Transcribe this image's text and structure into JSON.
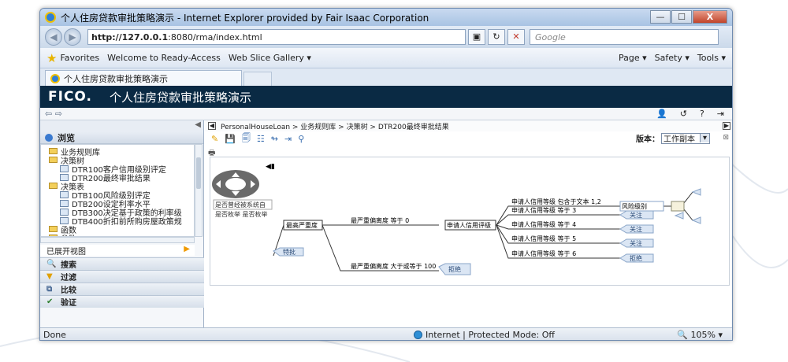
{
  "window": {
    "title": "个人住房贷款审批策略演示 - Internet Explorer provided by Fair Isaac Corporation",
    "controls": {
      "minimize": "—",
      "maximize": "☐",
      "close": "X"
    }
  },
  "address_bar": {
    "url_host": "http://127.0.0.1",
    "url_rest": ":8080/rma/index.html",
    "search_placeholder": "Google"
  },
  "favorites_bar": {
    "favorites_label": "Favorites",
    "links": [
      "Welcome to Ready-Access",
      "Web Slice Gallery ▾"
    ],
    "commands": [
      "Page ▾",
      "Safety ▾",
      "Tools ▾"
    ]
  },
  "tab": {
    "label": "个人住房贷款审批策略演示"
  },
  "app": {
    "logo": "FICO.",
    "title": "个人住房贷款审批策略演示"
  },
  "left_panel": {
    "browse_label": "浏览",
    "tree_items": [
      {
        "label": "业务规则库",
        "type": "folder",
        "indent": 1
      },
      {
        "label": "决策树",
        "type": "folder",
        "indent": 1
      },
      {
        "label": "DTR100客户信用级别评定",
        "type": "file",
        "indent": 2
      },
      {
        "label": "DTR200最终审批结果",
        "type": "file",
        "indent": 2
      },
      {
        "label": "决策表",
        "type": "folder",
        "indent": 1
      },
      {
        "label": "DTB100风险级别评定",
        "type": "file",
        "indent": 2
      },
      {
        "label": "DTB200设定利率水平",
        "type": "file",
        "indent": 2
      },
      {
        "label": "DTB300决定基于政策的利率级",
        "type": "file",
        "indent": 2
      },
      {
        "label": "DTB400折扣前所购房屋政策规",
        "type": "file",
        "indent": 2
      },
      {
        "label": "函数",
        "type": "folder",
        "indent": 1
      },
      {
        "label": "参数",
        "type": "folder",
        "indent": 1
      }
    ],
    "expand_all": "已展开视图",
    "accordion": [
      {
        "label": "搜索",
        "icon": "magnifier-icon"
      },
      {
        "label": "过滤",
        "icon": "filter-icon"
      },
      {
        "label": "比较",
        "icon": "compare-icon"
      },
      {
        "label": "验证",
        "icon": "check-icon"
      }
    ]
  },
  "breadcrumb": "PersonalHouseLoan > 业务规则库 > 决策树 > DTR200最终审批结果",
  "version": {
    "label": "版本：",
    "value": "工作副本"
  },
  "tree": {
    "legend_lines": [
      "是否曾经被系统自",
      "是否枚举 是否枚举"
    ],
    "root": "最高严重度",
    "left_child": "特批",
    "branch_top": "最严重偏离度 等于 0",
    "branch_bottom": "最严重偏离度 大于或等于 100",
    "mid_node": "申请人信用评级",
    "reject_bottom": "拒绝",
    "conditions": [
      "申请人信用等级 包含于文本 1,2",
      "申请人信用等级 等于 3",
      "申请人信用等级 等于 4",
      "申请人信用等级 等于 5",
      "申请人信用等级 等于 6"
    ],
    "outcomes": [
      "风险级别",
      "关注",
      "关注",
      "关注",
      "拒绝"
    ]
  },
  "status_bar": {
    "left": "Done",
    "zone": "Internet | Protected Mode: Off",
    "zoom": "105%"
  }
}
